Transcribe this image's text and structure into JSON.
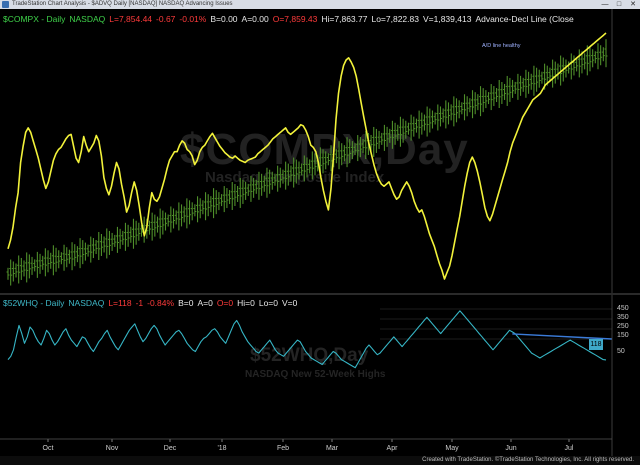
{
  "window": {
    "title": "TradeStation Chart Analysis - $ADVQ Daily [NASDAQ] NASDAQ Advancing Issues",
    "min_label": "—",
    "max_label": "□",
    "close_label": "✕"
  },
  "panel1": {
    "header": {
      "symbol": "$COMPX - Daily",
      "exchange": "NASDAQ",
      "last": "L=7,854.44",
      "chg": "-0.67",
      "pct": "-0.01%",
      "bid": "B=0.00",
      "ask": "A=0.00",
      "open": "O=7,859.43",
      "high": "Hi=7,863.77",
      "low": "Lo=7,822.83",
      "vol": "V=1,839,413",
      "study": "Advance-Decl Line (Close"
    },
    "watermark": "$COMPX,Day",
    "watermark_sub": "Nasdaq Composite Index",
    "annotation": "A/D line healthy"
  },
  "panel2": {
    "header": {
      "symbol": "$52WHQ - Daily",
      "exchange": "NASDAQ",
      "last": "L=118",
      "chg": "-1",
      "pct": "-0.84%",
      "bid": "B=0",
      "ask": "A=0",
      "open": "O=0",
      "high": "Hi=0",
      "low": "Lo=0",
      "vol": "V=0"
    },
    "watermark": "$52WHQ,Day",
    "watermark_sub": "NASDAQ New 52-Week Highs",
    "cursor_value": "118",
    "axis_labels": [
      "450",
      "350",
      "250",
      "150",
      "50"
    ]
  },
  "xaxis": {
    "labels": [
      "Oct",
      "Nov",
      "Dec",
      "'18",
      "Feb",
      "Mar",
      "Apr",
      "May",
      "Jun",
      "Jul"
    ]
  },
  "footer": "Created with TradeStation. ©TradeStation Technologies, Inc. All rights reserved.",
  "colors": {
    "price_bars": "#4f8f2a",
    "ad_line": "#f2f23a",
    "highs_line": "#36b6c6",
    "trendline": "#3b7bd8",
    "header_green": "#3fd24a",
    "header_red": "#ff3b3b",
    "header_cyan": "#3fb9c9"
  },
  "chart_data": [
    {
      "type": "line",
      "title": "$COMPX - Daily",
      "series": [
        {
          "name": "Advance-Decl Line (Close",
          "style": "line",
          "color": "#f2f23a",
          "values": [
            270,
            262,
            250,
            232,
            218,
            190,
            175,
            162,
            158,
            162,
            170,
            178,
            186,
            196,
            206,
            214,
            208,
            198,
            188,
            182,
            178,
            176,
            172,
            168,
            165,
            164,
            175,
            186,
            190,
            180,
            166,
            174,
            180,
            176,
            172,
            165,
            170,
            184,
            204,
            214,
            220,
            212,
            200,
            190,
            196,
            210,
            222,
            236,
            230,
            218,
            208,
            216,
            230,
            246,
            258,
            250,
            232,
            218,
            224,
            226,
            222,
            214,
            206,
            196,
            188,
            184,
            180,
            180,
            174,
            170,
            172,
            178,
            180,
            184,
            192,
            188,
            180,
            176,
            174,
            170,
            166,
            163,
            167,
            171,
            175,
            178,
            181,
            183,
            185,
            186,
            184,
            186,
            188,
            189,
            190,
            188,
            187,
            186,
            185,
            182,
            180,
            178,
            176,
            174,
            171,
            168,
            166,
            164,
            162,
            160,
            158,
            162,
            164,
            162,
            160,
            158,
            155,
            156,
            160,
            166,
            174,
            176,
            180,
            190,
            204,
            216,
            226,
            234,
            214,
            184,
            150,
            126,
            110,
            100,
            95,
            93,
            97,
            102,
            110,
            122,
            135,
            148,
            160,
            172,
            182,
            192,
            200,
            206,
            210,
            212,
            210,
            208,
            214,
            220,
            224,
            222,
            216,
            212,
            208,
            212,
            218,
            226,
            232,
            236,
            234,
            240,
            248,
            256,
            262,
            268,
            276,
            284,
            290,
            298,
            292,
            286,
            276,
            264,
            252,
            240,
            226,
            212,
            200,
            190,
            185,
            190,
            198,
            208,
            220,
            232,
            240,
            244,
            238,
            230,
            222,
            214,
            206,
            198,
            190,
            180,
            172,
            166,
            160,
            154,
            148,
            144,
            140,
            136,
            132,
            130,
            128,
            126,
            122,
            118,
            116,
            114,
            112,
            110,
            108,
            106,
            104,
            102,
            100,
            98,
            96,
            94,
            92,
            90,
            88,
            86,
            84,
            82,
            80,
            78,
            76,
            74,
            72,
            70
          ]
        },
        {
          "name": "$COMPX",
          "style": "ohlc-bars",
          "color": "#4f8f2a",
          "values": [
            205,
            210,
            214,
            218,
            222,
            224,
            226,
            230,
            234,
            236,
            238,
            240,
            244,
            248,
            250,
            254,
            256,
            258,
            260,
            262,
            266,
            268,
            270,
            272,
            274,
            278,
            282,
            286,
            290,
            292,
            296,
            300,
            306,
            310,
            314,
            318,
            320,
            324,
            326,
            330,
            334,
            338,
            342,
            346,
            350,
            354,
            358,
            362,
            366,
            370,
            374,
            378,
            382,
            386,
            390,
            394,
            398,
            402,
            406,
            410,
            414,
            418,
            422,
            426,
            430,
            434,
            438,
            442,
            446,
            450,
            454,
            458,
            462,
            466,
            470,
            474,
            478,
            482,
            486,
            490,
            494,
            498,
            502,
            506,
            510,
            514,
            518,
            522,
            526,
            530,
            534,
            538,
            542,
            546,
            550,
            554,
            558,
            562,
            566,
            570,
            574,
            578,
            582,
            586,
            590,
            594,
            598,
            602,
            606,
            610,
            614,
            618,
            622,
            626,
            630,
            634,
            638,
            642,
            646,
            650,
            654,
            658,
            662,
            666,
            670,
            674,
            678,
            682,
            686,
            690,
            694,
            698,
            702,
            706,
            710,
            714,
            718,
            722,
            726,
            730,
            734,
            738,
            742,
            746,
            750,
            754,
            758,
            762,
            766,
            770,
            774,
            778,
            782,
            786,
            790,
            794,
            798,
            802,
            806,
            810,
            814,
            818,
            822,
            826,
            830,
            834,
            838,
            842,
            846,
            850,
            854,
            858,
            862,
            866,
            870,
            874,
            878,
            882,
            886,
            890,
            894,
            898,
            902,
            906,
            910,
            914,
            918,
            922,
            926,
            930,
            934,
            938,
            942,
            946,
            950,
            954,
            958,
            962,
            966,
            970,
            974,
            978,
            982,
            986,
            990,
            994,
            998,
            1002,
            1006,
            1010,
            1014,
            1018,
            1022,
            1026,
            1030,
            1034,
            1038,
            1042,
            1046,
            1050,
            1054,
            1058,
            1062,
            1066,
            1070
          ]
        }
      ]
    },
    {
      "type": "line",
      "title": "$52WHQ - Daily",
      "yticks": [
        450,
        350,
        250,
        150,
        50
      ],
      "series": [
        {
          "name": "$52WHQ",
          "color": "#36b6c6",
          "values": [
            120,
            140,
            180,
            260,
            330,
            280,
            220,
            260,
            320,
            300,
            260,
            230,
            210,
            250,
            300,
            280,
            240,
            210,
            230,
            260,
            290,
            310,
            270,
            240,
            220,
            200,
            230,
            260,
            250,
            220,
            190,
            170,
            200,
            230,
            250,
            280,
            300,
            260,
            230,
            200,
            180,
            210,
            240,
            270,
            300,
            320,
            340,
            300,
            260,
            230,
            250,
            280,
            310,
            330,
            310,
            270,
            240,
            210,
            230,
            250,
            270,
            290,
            300,
            280,
            250,
            220,
            200,
            180,
            170,
            200,
            230,
            250,
            260,
            280,
            300,
            310,
            290,
            260,
            240,
            220,
            260,
            300,
            340,
            360,
            330,
            290,
            260,
            230,
            210,
            190,
            170,
            160,
            180,
            200,
            220,
            240,
            210,
            180,
            160,
            150,
            140,
            160,
            180,
            200,
            220,
            240,
            230,
            200,
            170,
            150,
            130,
            120,
            110,
            100,
            90,
            110,
            130,
            150,
            170,
            160,
            140,
            120,
            110,
            100,
            90,
            80,
            70,
            100,
            130,
            160,
            190,
            210,
            190,
            170,
            150,
            160,
            180,
            200,
            220,
            240,
            260,
            240,
            220,
            200,
            220,
            240,
            260,
            280,
            300,
            320,
            340,
            360,
            380,
            360,
            340,
            320,
            300,
            280,
            300,
            320,
            340,
            360,
            380,
            400,
            420,
            400,
            380,
            360,
            340,
            320,
            300,
            280,
            260,
            240,
            220,
            200,
            180,
            200,
            220,
            240,
            260,
            280,
            300,
            290,
            280,
            260,
            240,
            220,
            200,
            180,
            160,
            150,
            140,
            130,
            140,
            150,
            160,
            170,
            180,
            190,
            200,
            210,
            220,
            230,
            240,
            230,
            220,
            210,
            200,
            190,
            180,
            170,
            160,
            150,
            140,
            130,
            120,
            118
          ]
        }
      ]
    }
  ]
}
